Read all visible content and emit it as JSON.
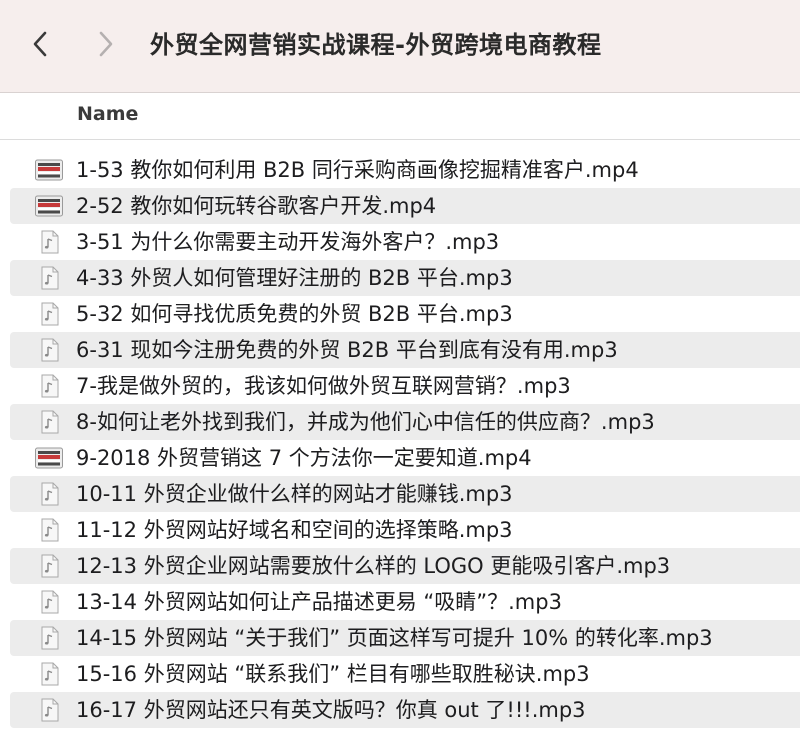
{
  "window": {
    "title": "外贸全网营销实战课程-外贸跨境电商教程"
  },
  "nav": {
    "back_icon": "chevron-left-icon",
    "forward_icon": "chevron-right-icon"
  },
  "columns": {
    "name": "Name"
  },
  "files": [
    {
      "name": "1-53 教你如何利用 B2B 同行采购商画像挖掘精准客户.mp4",
      "type": "video"
    },
    {
      "name": "2-52 教你如何玩转谷歌客户开发.mp4",
      "type": "video"
    },
    {
      "name": "3-51 为什么你需要主动开发海外客户？.mp3",
      "type": "audio"
    },
    {
      "name": "4-33 外贸人如何管理好注册的 B2B 平台.mp3",
      "type": "audio"
    },
    {
      "name": "5-32 如何寻找优质免费的外贸 B2B 平台.mp3",
      "type": "audio"
    },
    {
      "name": "6-31 现如今注册免费的外贸 B2B 平台到底有没有用.mp3",
      "type": "audio"
    },
    {
      "name": "7-我是做外贸的，我该如何做外贸互联网营销？.mp3",
      "type": "audio"
    },
    {
      "name": "8-如何让老外找到我们，并成为他们心中信任的供应商？.mp3",
      "type": "audio"
    },
    {
      "name": "9-2018 外贸营销这 7 个方法你一定要知道.mp4",
      "type": "video"
    },
    {
      "name": "10-11 外贸企业做什么样的网站才能赚钱.mp3",
      "type": "audio"
    },
    {
      "name": "11-12 外贸网站好域名和空间的选择策略.mp3",
      "type": "audio"
    },
    {
      "name": "12-13 外贸企业网站需要放什么样的 LOGO 更能吸引客户.mp3",
      "type": "audio"
    },
    {
      "name": "13-14 外贸网站如何让产品描述更易 “吸睛”？.mp3",
      "type": "audio"
    },
    {
      "name": "14-15 外贸网站 “关于我们” 页面这样写可提升 10% 的转化率.mp3",
      "type": "audio"
    },
    {
      "name": "15-16 外贸网站 “联系我们” 栏目有哪些取胜秘诀.mp3",
      "type": "audio"
    },
    {
      "name": "16-17 外贸网站还只有英文版吗？你真 out 了!!!.mp3",
      "type": "audio"
    }
  ]
}
